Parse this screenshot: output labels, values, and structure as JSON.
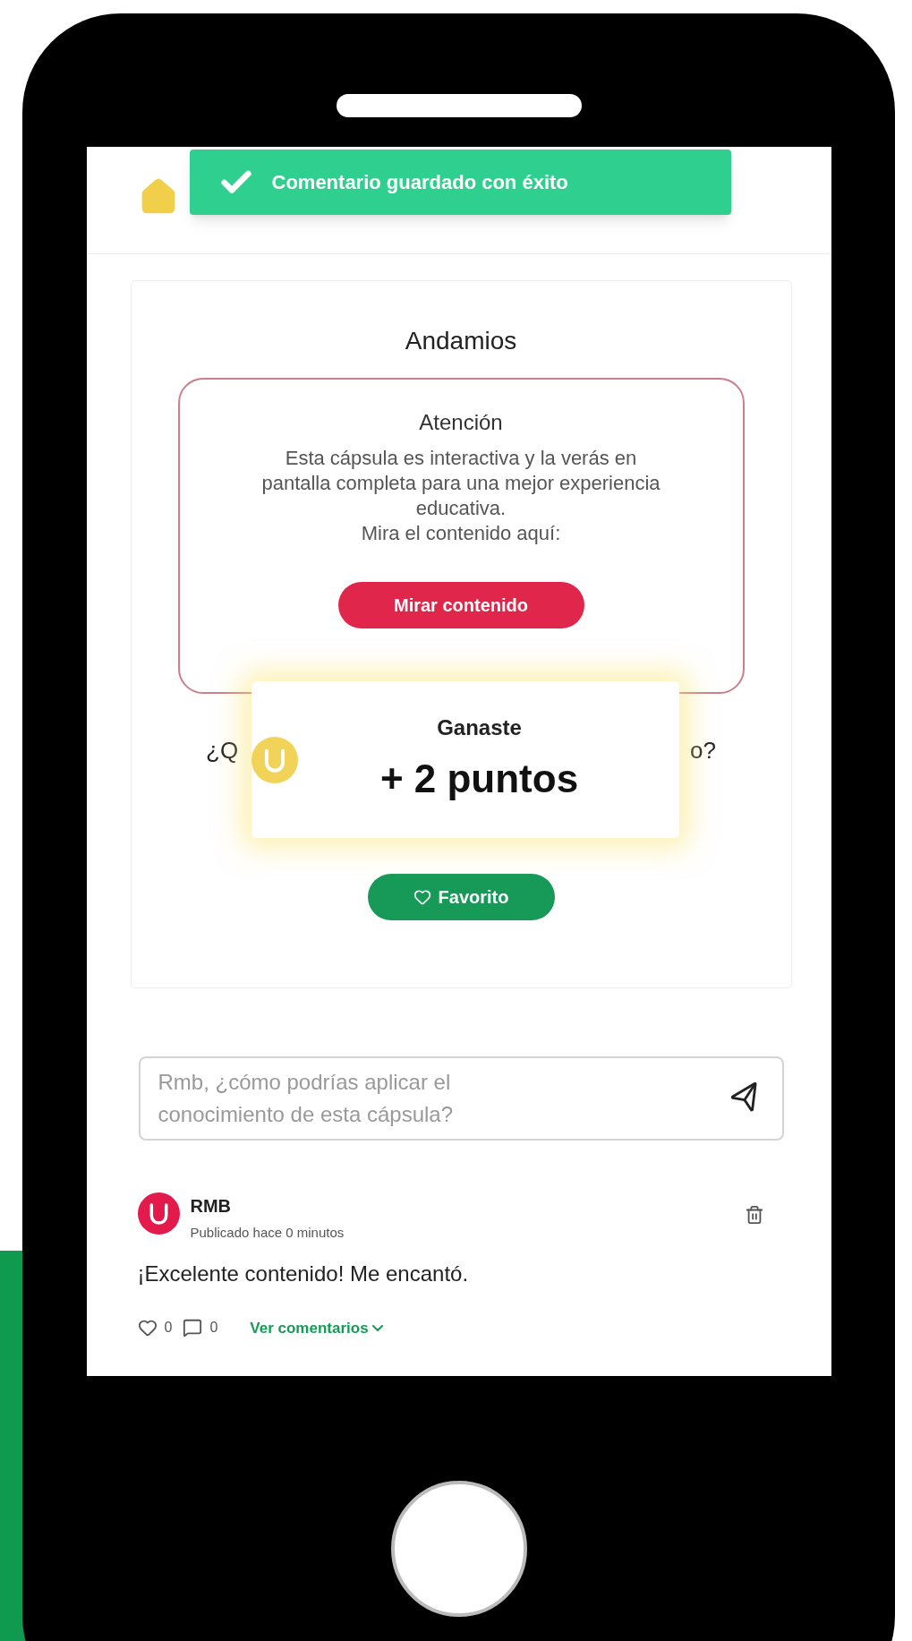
{
  "toast": {
    "message": "Comentario guardado con éxito"
  },
  "card": {
    "title": "Andamios",
    "notice": {
      "heading": "Atención",
      "body": "Esta cápsula es interactiva y la verás en pantalla completa para una mejor experiencia educativa.",
      "prompt": "Mira el contenido aquí:",
      "button": "Mirar contenido"
    },
    "question_parts": [
      "¿Q",
      "o?"
    ],
    "favorite_button": "Favorito"
  },
  "reward_popup": {
    "title": "Ganaste",
    "points": "+ 2 puntos"
  },
  "comment_box": {
    "placeholder": "Rmb, ¿cómo podrías aplicar el conocimiento de esta cápsula?"
  },
  "comments": [
    {
      "author": "RMB",
      "time": "Publicado hace 0 minutos",
      "text": "¡Excelente contenido! Me encantó.",
      "likes": "0",
      "replies": "0",
      "toggle": "Ver comentarios"
    }
  ]
}
